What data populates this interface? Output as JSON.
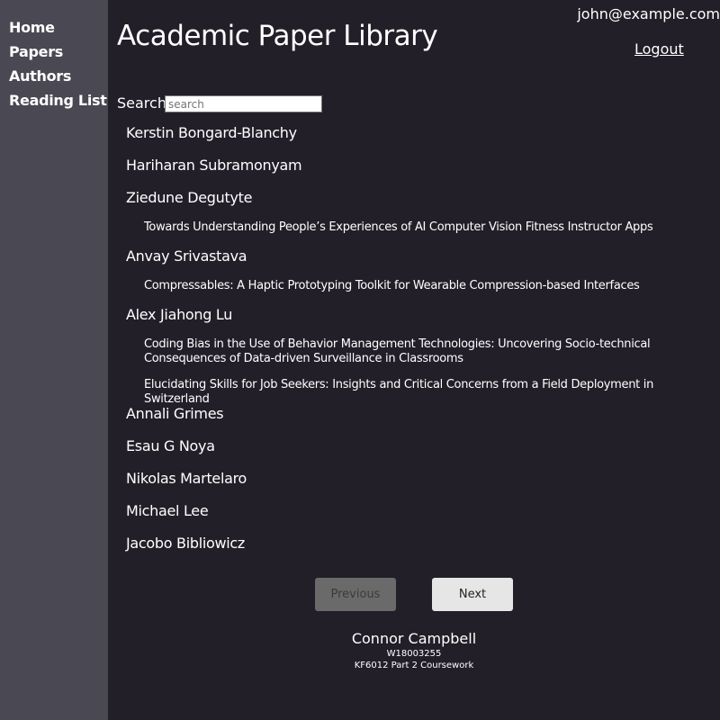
{
  "nav": {
    "items": [
      {
        "label": "Home"
      },
      {
        "label": "Papers"
      },
      {
        "label": "Authors"
      },
      {
        "label": "Reading List"
      }
    ]
  },
  "header": {
    "title": "Academic Paper Library",
    "user_email": "john@example.com",
    "logout_label": "Logout"
  },
  "search": {
    "label": "Search:",
    "placeholder": "search",
    "value": ""
  },
  "authors": [
    {
      "name": "Kerstin Bongard-Blanchy",
      "papers": []
    },
    {
      "name": "Hariharan Subramonyam",
      "papers": []
    },
    {
      "name": "Ziedune Degutyte",
      "papers": [
        "Towards Understanding People’s Experiences of AI Computer Vision Fitness Instructor Apps"
      ]
    },
    {
      "name": "Anvay Srivastava",
      "papers": [
        "Compressables: A Haptic Prototyping Toolkit for Wearable Compression-based Interfaces"
      ]
    },
    {
      "name": "Alex Jiahong Lu",
      "papers": [
        "Coding Bias in the Use of Behavior Management Technologies: Uncovering Socio-technical Consequences of Data-driven Surveillance in Classrooms",
        "Elucidating Skills for Job Seekers: Insights and Critical Concerns from a Field Deployment in Switzerland"
      ]
    },
    {
      "name": "Annali Grimes",
      "papers": []
    },
    {
      "name": "Esau G Noya",
      "papers": []
    },
    {
      "name": "Nikolas Martelaro",
      "papers": []
    },
    {
      "name": "Michael Lee",
      "papers": []
    },
    {
      "name": "Jacobo Bibliowicz",
      "papers": []
    }
  ],
  "pagination": {
    "previous_label": "Previous",
    "next_label": "Next"
  },
  "footer": {
    "name": "Connor Campbell",
    "id": "W18003255",
    "course": "KF6012 Part 2 Coursework"
  }
}
